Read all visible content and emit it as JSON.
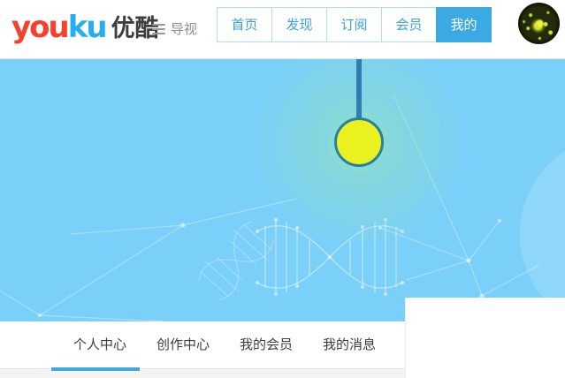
{
  "header": {
    "logo": {
      "latin_you": "you",
      "latin_ku": "ku",
      "cn": "优酷",
      "color_red": "#f5402e",
      "color_blue": "#27aef2"
    },
    "guide": {
      "label": "导视",
      "icon": "hamburger-icon"
    },
    "nav_tabs": [
      {
        "label": "首页",
        "active": false
      },
      {
        "label": "发现",
        "active": false
      },
      {
        "label": "订阅",
        "active": false
      },
      {
        "label": "会员",
        "active": false
      },
      {
        "label": "我的",
        "active": true
      }
    ],
    "avatar": {
      "icon": "user-avatar-image"
    }
  },
  "banner": {
    "background": "#7bd0fa",
    "pin": {
      "dot_color": "#e9f21f",
      "dot_border": "#27809f",
      "line_color": "#2e7db4",
      "ripple_color": "#90e2be"
    },
    "decorations": [
      "dna-helix",
      "constellation-lines",
      "light-circle"
    ]
  },
  "profile_tabs": {
    "items": [
      {
        "label": "个人中心",
        "active": true
      },
      {
        "label": "创作中心",
        "active": false
      },
      {
        "label": "我的会员",
        "active": false
      },
      {
        "label": "我的消息",
        "active": false
      }
    ],
    "underline_color": "#41a7dc"
  },
  "colors": {
    "nav_text": "#3aa2d9",
    "nav_active_bg": "#3caae2",
    "nav_border": "#b3ddf3",
    "tab_text": "#3e3e3e",
    "header_border": "#e7e7e7"
  }
}
